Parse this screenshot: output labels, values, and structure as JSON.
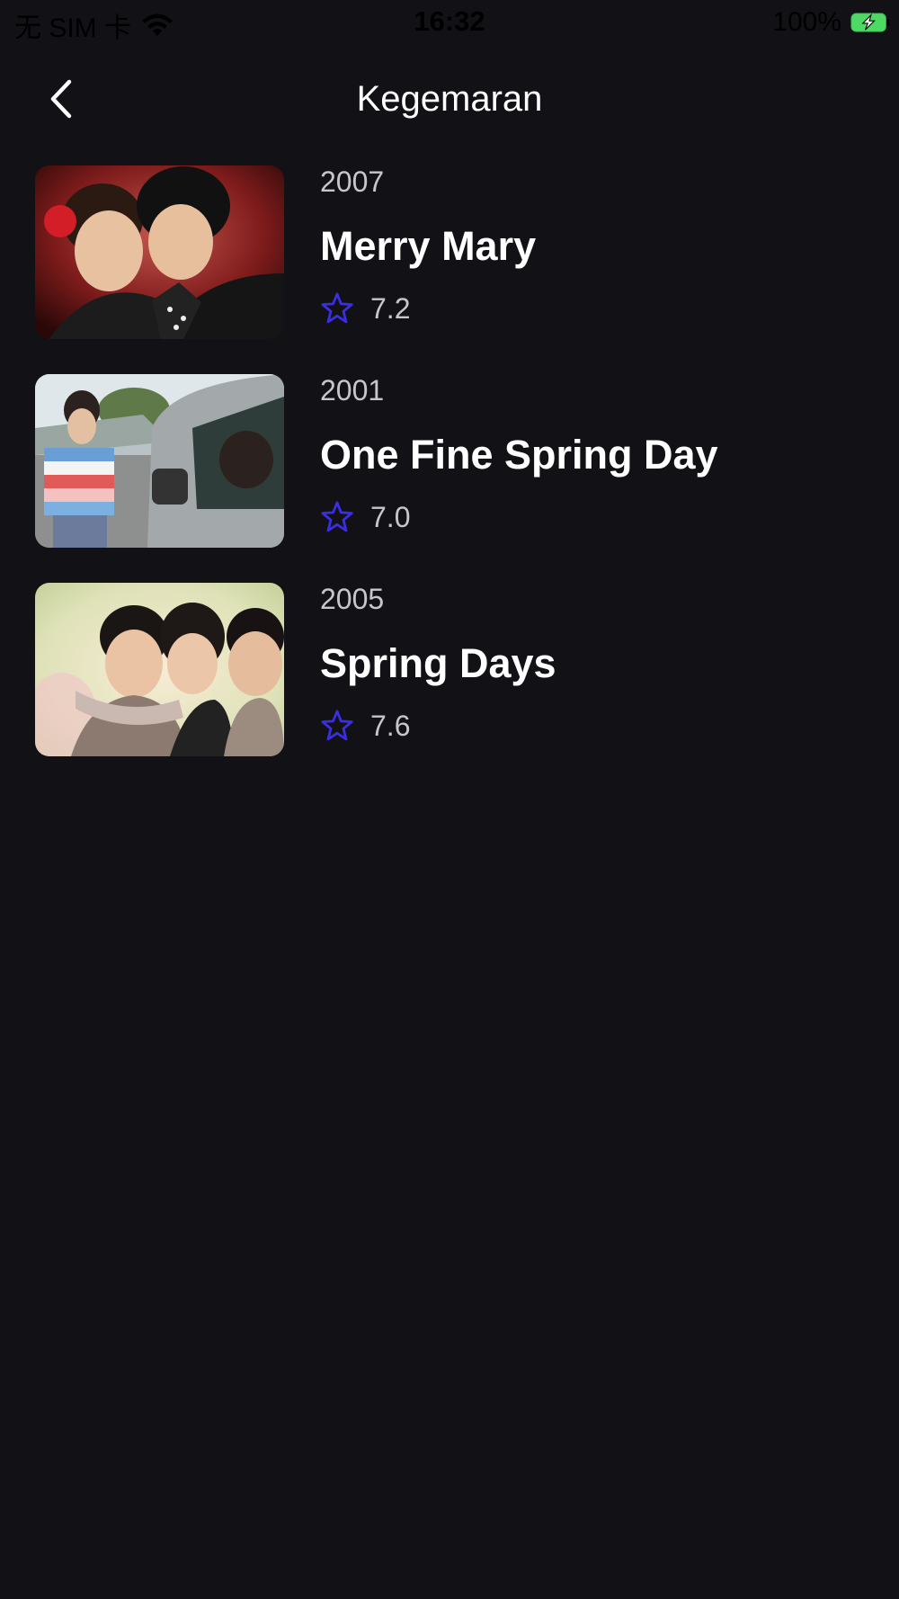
{
  "status_bar": {
    "carrier": "无 SIM 卡",
    "time": "16:32",
    "battery": "100%"
  },
  "header": {
    "title": "Kegemaran",
    "back_icon": "chevron-left-icon"
  },
  "accent_color": "#3a2ee0",
  "favorites": [
    {
      "year": "2007",
      "title": "Merry Mary",
      "rating": "7.2"
    },
    {
      "year": "2001",
      "title": "One Fine Spring Day",
      "rating": "7.0"
    },
    {
      "year": "2005",
      "title": "Spring Days",
      "rating": "7.6"
    }
  ]
}
